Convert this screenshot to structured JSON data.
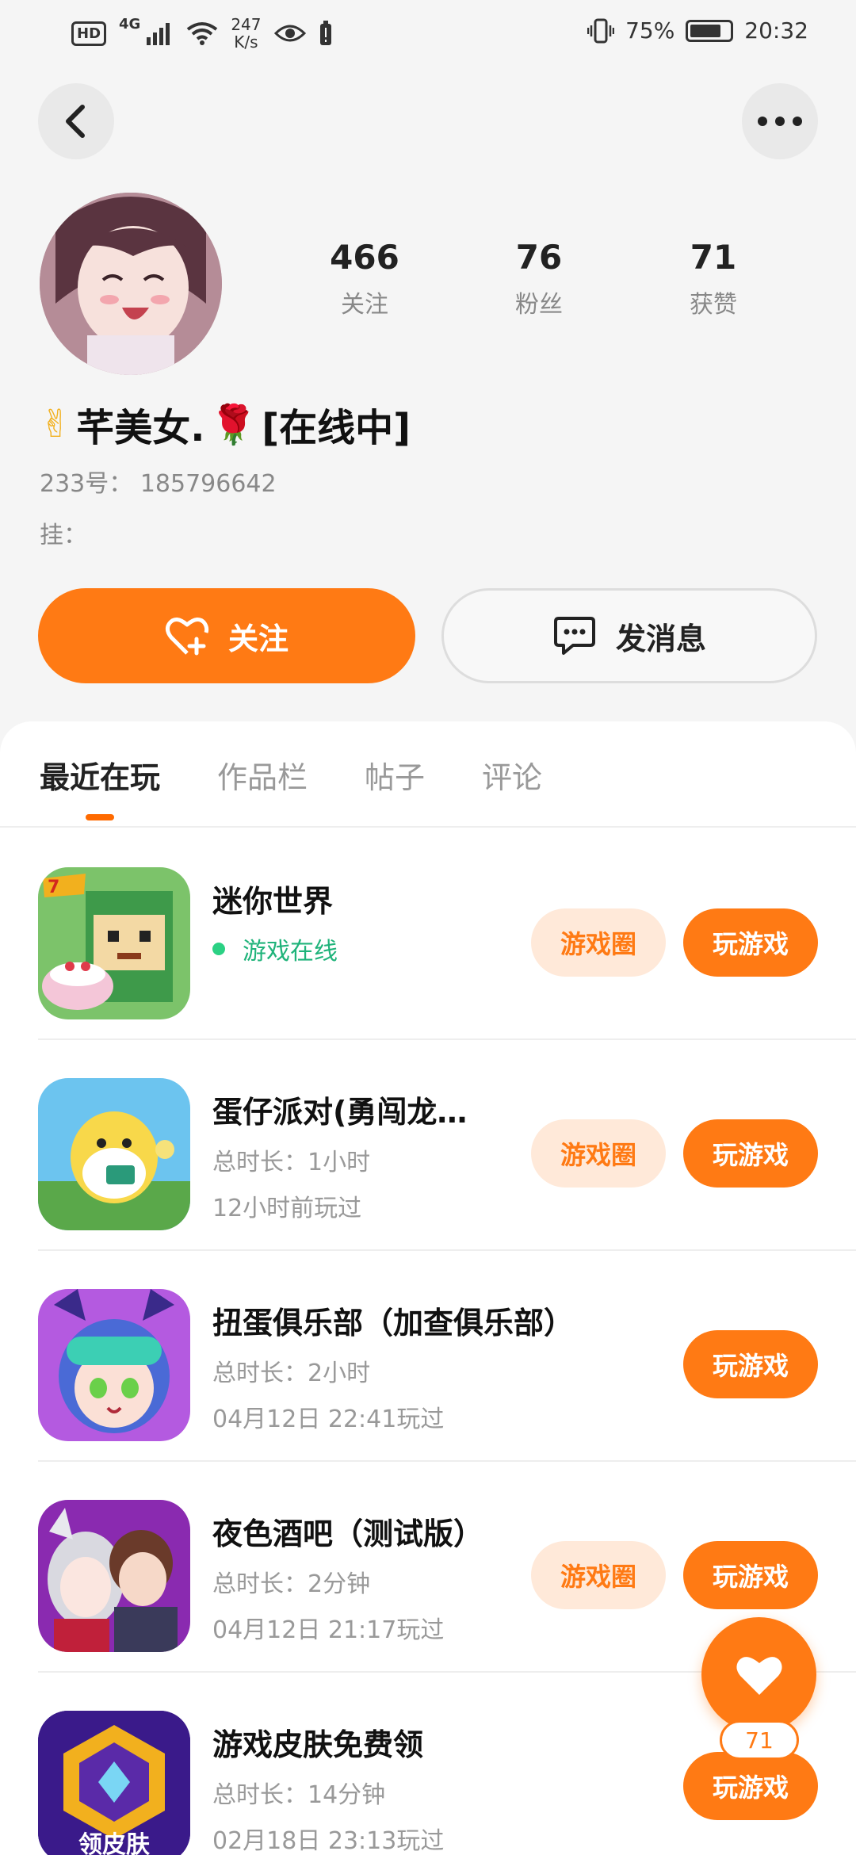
{
  "status_bar": {
    "hd": "HD",
    "network": "4G",
    "speed_value": "247",
    "speed_unit": "K/s",
    "battery": "75%",
    "time": "20:32"
  },
  "profile": {
    "nickname": "芊美女.",
    "online_tag": "[在线中]",
    "emoji_left": "✌",
    "emoji_rose": "🌹",
    "uid_label": "233号：",
    "uid": "185796642",
    "signature_label": "挂：",
    "stats": [
      {
        "value": "466",
        "label": "关注"
      },
      {
        "value": "76",
        "label": "粉丝"
      },
      {
        "value": "71",
        "label": "获赞"
      }
    ]
  },
  "actions": {
    "follow": "关注",
    "message": "发消息"
  },
  "tabs": [
    "最近在玩",
    "作品栏",
    "帖子",
    "评论"
  ],
  "games": [
    {
      "title": "迷你世界",
      "online": "游戏在线",
      "circle": "游戏圈",
      "play": "玩游戏"
    },
    {
      "title": "蛋仔派对(勇闯龙…",
      "line1": "总时长：1小时",
      "line2": "12小时前玩过",
      "circle": "游戏圈",
      "play": "玩游戏"
    },
    {
      "title": "扭蛋俱乐部（加查俱乐部）",
      "line1": "总时长：2小时",
      "line2": "04月12日 22:41玩过",
      "play": "玩游戏"
    },
    {
      "title": "夜色酒吧（测试版）",
      "line1": "总时长：2分钟",
      "line2": "04月12日 21:17玩过",
      "circle": "游戏圈",
      "play": "玩游戏"
    },
    {
      "title": "游戏皮肤免费领",
      "line1": "总时长：14分钟",
      "line2": "02月18日 23:13玩过",
      "play": "玩游戏",
      "icon_text": "领皮肤"
    }
  ],
  "like_fab": {
    "count": "71"
  },
  "colors": {
    "accent": "#ff7a14",
    "accent_light": "#ffe9d9",
    "online": "#1fb37a"
  }
}
